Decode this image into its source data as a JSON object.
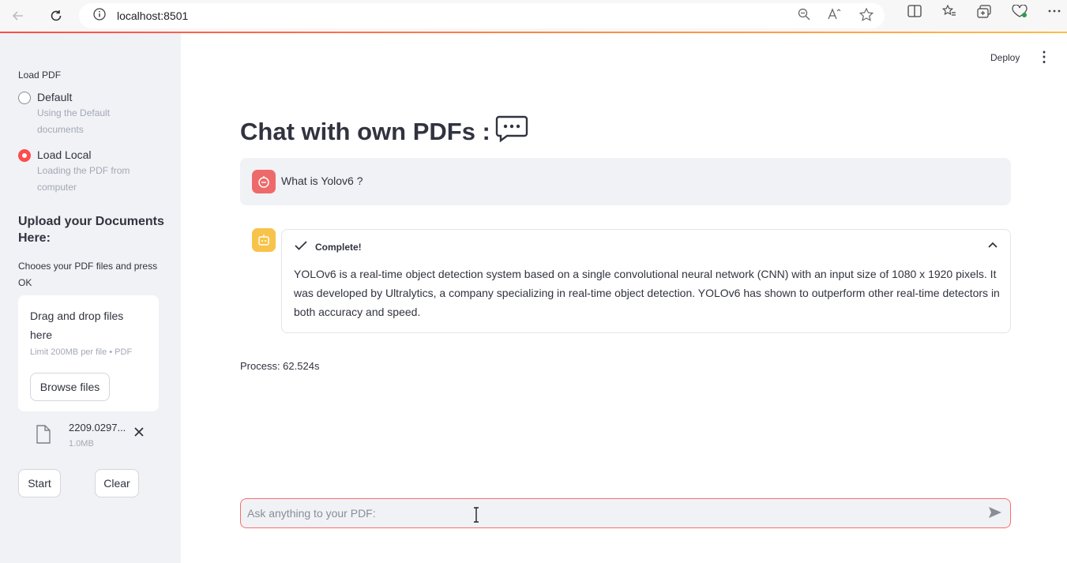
{
  "browser": {
    "url": "localhost:8501"
  },
  "sidebar": {
    "load_label": "Load PDF",
    "options": [
      {
        "label": "Default",
        "help": "Using the Default documents",
        "selected": false
      },
      {
        "label": "Load Local",
        "help": "Loading the PDF from computer",
        "selected": true
      }
    ],
    "upload_title": "Upload your Documents Here:",
    "upload_help": "Chooes your PDF files and press OK",
    "dropzone": {
      "title": "Drag and drop files here",
      "limit": "Limit 200MB per file • PDF",
      "browse_label": "Browse files"
    },
    "file": {
      "name": "2209.0297...",
      "size": "1.0MB"
    },
    "start_label": "Start",
    "clear_label": "Clear"
  },
  "header": {
    "deploy_label": "Deploy",
    "menu_glyph": "⋮"
  },
  "main": {
    "title": "Chat with own PDFs :",
    "user_message": "What is Yolov6 ?",
    "status_label": "Complete!",
    "answer": "YOLOv6 is a real-time object detection system based on a single convolutional neural network (CNN) with an input size of 1080 x 1920 pixels. It was developed by Ultralytics, a company specializing in real-time object detection. YOLOv6 has shown to outperform other real-time detectors in both accuracy and speed.",
    "process_text": "Process: 62.524s",
    "chat_placeholder": "Ask anything to your PDF:"
  },
  "colors": {
    "accent": "#ff4b4b",
    "sidebar_bg": "#f0f2f6",
    "user_avatar": "#ee6a6a",
    "assistant_avatar": "#f8c34a"
  }
}
